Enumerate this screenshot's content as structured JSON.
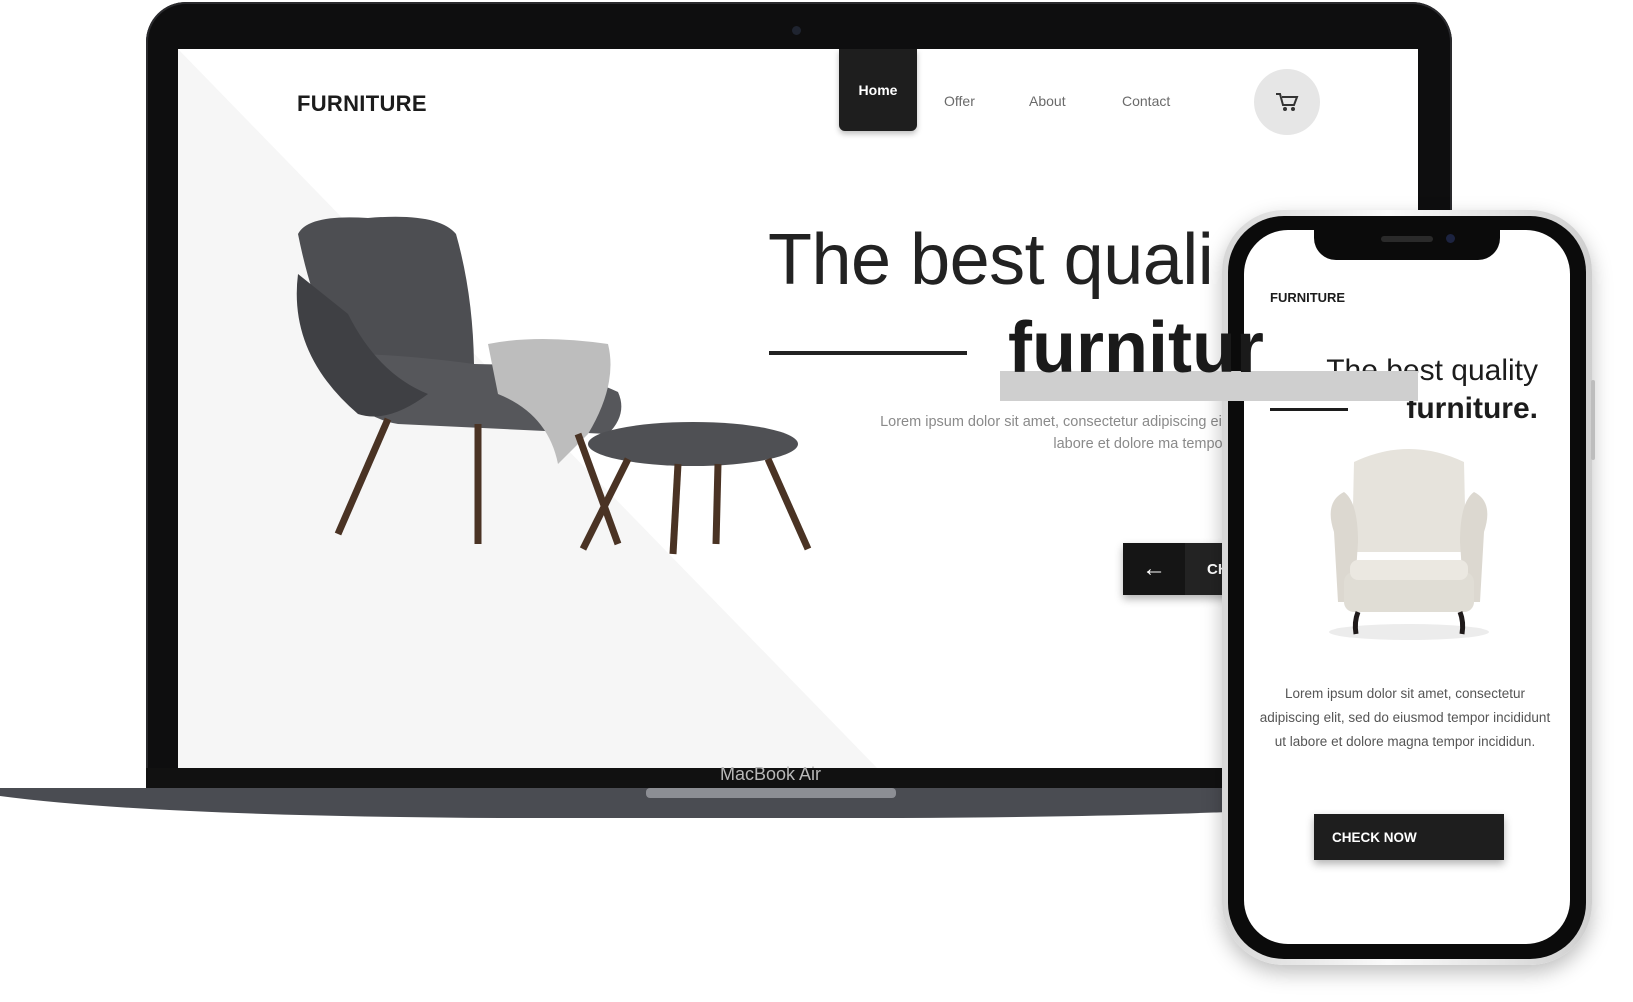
{
  "laptop": {
    "device_label": "MacBook Air",
    "site": {
      "brand": "FURNITURE",
      "nav": {
        "home": "Home",
        "offer": "Offer",
        "about": "About",
        "contact": "Contact"
      },
      "cart_icon": "cart-icon",
      "hero": {
        "title_line1": "The best quali",
        "title_line2": "furnitur",
        "description": "Lorem ipsum dolor sit amet, consectetur adipiscing eiusmod tempor incididunt ut labore et dolore ma tempo",
        "button_arrow": "←",
        "button_label": "CHEC"
      }
    }
  },
  "phone": {
    "site": {
      "brand": "FURNITURE",
      "hero": {
        "title_line1": "The best quality",
        "title_line2": "furniture.",
        "description": "Lorem ipsum dolor sit amet, consectetur adipiscing elit, sed do eiusmod tempor incididunt ut labore et dolore magna tempor incididun.",
        "button_label": "CHECK NOW"
      }
    }
  },
  "colors": {
    "dark": "#1e1e1e",
    "muted_text": "#8a8a8a",
    "cart_bg": "#e6e6e6"
  }
}
